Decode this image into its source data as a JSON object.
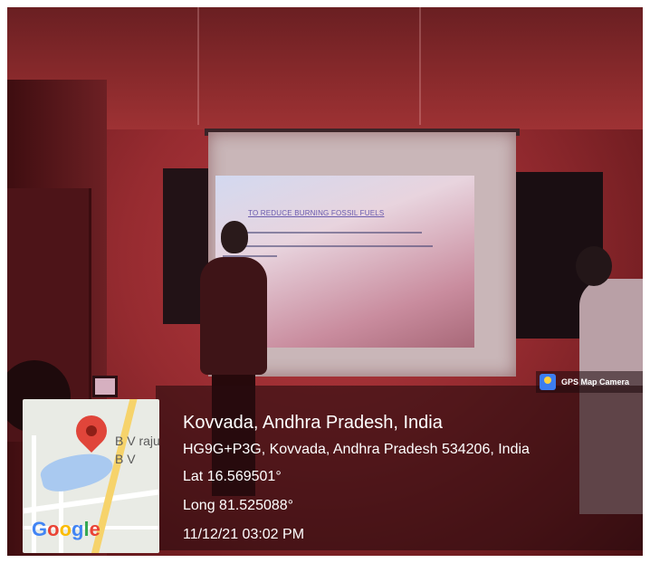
{
  "gps_overlay": {
    "badge_label": "GPS Map Camera",
    "location_title": "Kovvada, Andhra Pradesh, India",
    "address": "HG9G+P3G, Kovvada, Andhra Pradesh 534206, India",
    "latitude": "Lat 16.569501°",
    "longitude": "Long 81.525088°",
    "timestamp": "11/12/21 03:02 PM",
    "icon": "gps-map-camera-icon"
  },
  "map_thumbnail": {
    "place_label_1": "B V raju",
    "place_label_2": "B V",
    "logo_text": "Google",
    "pin_icon": "location-pin-icon",
    "colors": {
      "pin": "#e0453a",
      "water": "#a9c9f0",
      "road_major": "#f6d36b"
    }
  },
  "slide": {
    "heading": "TO REDUCE BURNING FOSSIL FUELS"
  }
}
